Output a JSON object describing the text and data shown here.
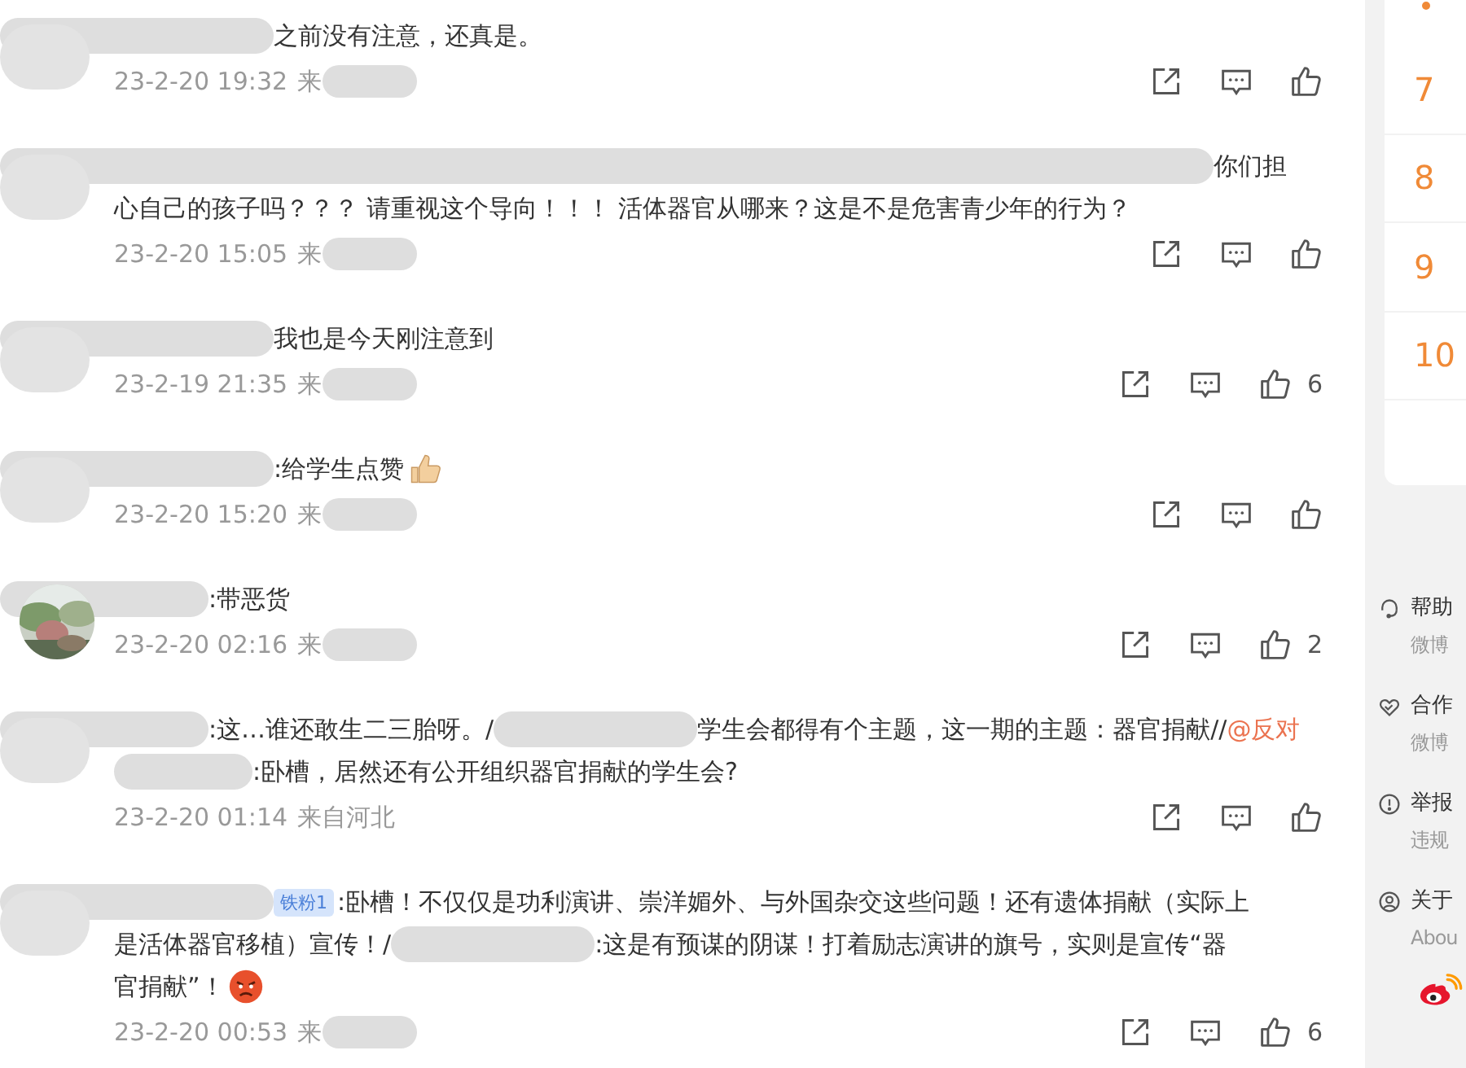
{
  "comments": [
    {
      "avatar": {
        "kind": "redacted"
      },
      "lines": [
        [
          {
            "kind": "name_redaction"
          },
          {
            "kind": "text",
            "text": "之前没有注意，还真是。"
          }
        ]
      ],
      "meta": {
        "time": "23-2-20 19:32",
        "source": "来",
        "source_redacted": true
      }
    },
    {
      "avatar": {
        "kind": "redacted"
      },
      "lines": [
        [
          {
            "kind": "line_redaction"
          },
          {
            "kind": "text",
            "text": "你们担"
          }
        ],
        [
          {
            "kind": "text",
            "text": "心自己的孩子吗？？？ 请重视这个导向！！！ 活体器官从哪来？这是不是危害青少年的行为？"
          }
        ]
      ],
      "meta": {
        "time": "23-2-20 15:05",
        "source": "来",
        "source_redacted": true
      }
    },
    {
      "avatar": {
        "kind": "redacted"
      },
      "lines": [
        [
          {
            "kind": "name_redaction"
          },
          {
            "kind": "text",
            "text": "我也是今天刚注意到"
          }
        ]
      ],
      "meta": {
        "time": "23-2-19 21:35",
        "source": "来",
        "source_redacted": true
      },
      "likes": "6"
    },
    {
      "avatar": {
        "kind": "redacted"
      },
      "lines": [
        [
          {
            "kind": "name_redaction"
          },
          {
            "kind": "text",
            "text": ":给学生点赞"
          },
          {
            "kind": "thumbs_up_emoji"
          }
        ]
      ],
      "meta": {
        "time": "23-2-20 15:20",
        "source": "来",
        "source_redacted": true
      }
    },
    {
      "avatar": {
        "kind": "picture"
      },
      "lines": [
        [
          {
            "kind": "short_name_redaction"
          },
          {
            "kind": "text",
            "text": ":带恶货"
          }
        ]
      ],
      "meta": {
        "time": "23-2-20 02:16",
        "source": "来",
        "source_redacted": true
      },
      "likes": "2"
    },
    {
      "avatar": {
        "kind": "redacted"
      },
      "lines": [
        [
          {
            "kind": "short_name_redaction"
          },
          {
            "kind": "text",
            "text": ":这…谁还敢生二三胎呀。/"
          },
          {
            "kind": "redaction"
          },
          {
            "kind": "text",
            "text": "学生会都得有个主题，这一期的主题：器官捐献//"
          },
          {
            "kind": "link",
            "text": "@反对"
          }
        ],
        [
          {
            "kind": "short_redaction"
          },
          {
            "kind": "text",
            "text": ":卧槽，居然还有公开组织器官捐献的学生会?"
          }
        ]
      ],
      "meta": {
        "time": "23-2-20 01:14",
        "source": "来自河北",
        "source_redacted": false
      }
    },
    {
      "avatar": {
        "kind": "redacted"
      },
      "lines": [
        [
          {
            "kind": "name_redaction"
          },
          {
            "kind": "badge",
            "text": "铁粉1"
          },
          {
            "kind": "text",
            "text": ":卧槽！不仅仅是功利演讲、崇洋媚外、与外国杂交这些问题！还有遗体捐献（实际上"
          }
        ],
        [
          {
            "kind": "text",
            "text": "是活体器官移植）宣传！/"
          },
          {
            "kind": "redaction"
          },
          {
            "kind": "text",
            "text": ":这是有预谋的阴谋！打着励志演讲的旗号，实则是宣传“器"
          }
        ],
        [
          {
            "kind": "text",
            "text": "官捐献”！"
          },
          {
            "kind": "angry_emoji"
          }
        ]
      ],
      "meta": {
        "time": "23-2-20 00:53",
        "source": "来",
        "source_redacted": true
      },
      "likes": "6"
    }
  ],
  "ranking": [
    "7",
    "8",
    "9",
    "10"
  ],
  "footer": [
    {
      "title": "帮助",
      "subtitle": "微博"
    },
    {
      "title": "合作",
      "subtitle": "微博"
    },
    {
      "title": "举报",
      "subtitle": "违规"
    },
    {
      "title": "关于",
      "subtitle": "Abou"
    }
  ]
}
